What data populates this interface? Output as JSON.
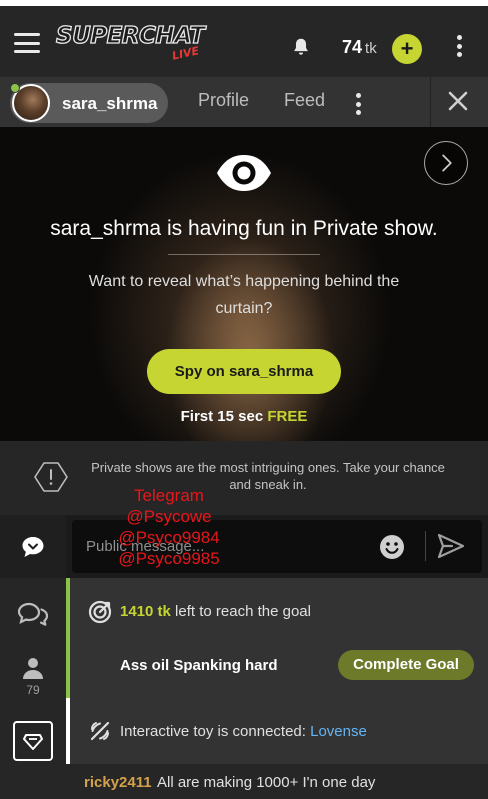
{
  "header": {
    "logo_text": "SUPERCHAT",
    "logo_sub": "LIVE",
    "token_balance": "74",
    "token_unit": "tk",
    "add_label": "+"
  },
  "tabs": {
    "username": "sara_shrma",
    "items": [
      {
        "label": "Profile"
      },
      {
        "label": "Feed"
      }
    ]
  },
  "hero": {
    "title": "sara_shrma is having fun in Private show.",
    "subtitle": "Want to reveal what’s happening behind the curtain?",
    "button_label": "Spy on sara_shrma",
    "free_prefix": "First 15 sec ",
    "free_label": "FREE"
  },
  "info": {
    "text": "Private shows are the most intriguing ones. Take your chance and sneak in."
  },
  "rail": {
    "viewer_count": "79"
  },
  "message": {
    "placeholder": "Public message..."
  },
  "goal": {
    "amount": "1410 tk",
    "text": " left to reach the goal",
    "title": "Ass oil Spanking hard",
    "button_label": "Complete Goal"
  },
  "toy": {
    "text": "Interactive toy is connected: ",
    "link": "Lovense"
  },
  "chat": {
    "username": "ricky2411",
    "text": "All are making 1000+ I'n one day"
  },
  "watermark": {
    "lines": [
      "Telegram",
      "@Psycowe",
      "@Psyco9984",
      "@Psyco9985"
    ]
  },
  "colors": {
    "accent": "#c6d531",
    "goal_border": "#8bc34a",
    "link": "#64b5f6",
    "username": "#d4a24c",
    "watermark": "#e8161b"
  },
  "icons": [
    "menu-icon",
    "bell-icon",
    "plus-icon",
    "more-vertical-icon",
    "close-icon",
    "chevron-right-icon",
    "eye-icon",
    "alert-octagon-icon",
    "chat-bubble-icon",
    "chat-group-icon",
    "user-icon",
    "tip-diamond-icon",
    "emoji-icon",
    "send-icon",
    "target-icon",
    "toy-icon"
  ]
}
